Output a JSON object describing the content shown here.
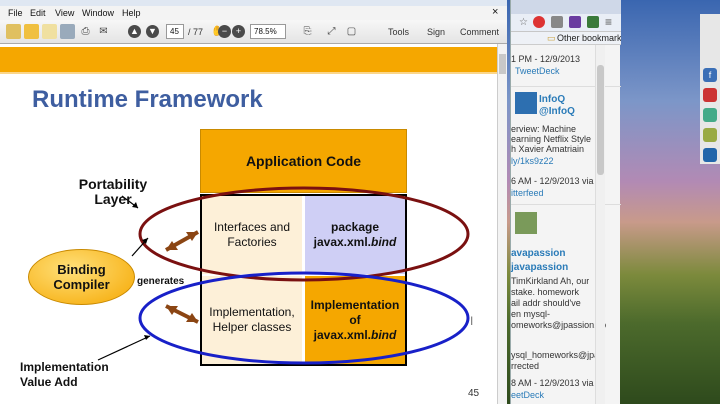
{
  "reader": {
    "menu": [
      "File",
      "Edit",
      "View",
      "Window",
      "Help"
    ],
    "page_current": "45",
    "page_total": "/ 77",
    "zoom": "78.5%",
    "tools_label": "Tools",
    "sign_label": "Sign",
    "comment_label": "Comment"
  },
  "slide": {
    "title": "Runtime Framework",
    "app_code": "Application Code",
    "portability": "Portability Layer",
    "interfaces": "Interfaces and Factories",
    "package_line1": "package",
    "package_line2": "javax.xml.",
    "package_italic": "bind",
    "binding_compiler": "Binding Compiler",
    "generates": "generates",
    "impl_helper": "Implementation, Helper classes",
    "impl_of_1": "Implementation",
    "impl_of_2": "of",
    "impl_of_3": "javax.xml.",
    "impl_of_italic": "bind",
    "impl_value_add": "Implementation Value Add",
    "page_number": "45"
  },
  "browser": {
    "bookmarks": "Other bookmarks",
    "tweets": [
      {
        "line1": "1 PM - 12/9/2013",
        "line2": "TweetDeck"
      },
      {
        "name": "InfoQ",
        "handle": "@InfoQ",
        "body": [
          "erview: Machine",
          "earning Netflix Style",
          "h Xavier Amatriain",
          "ly/1ks9z22"
        ],
        "time": "6 AM - 12/9/2013 via",
        "via": "itterfeed"
      },
      {
        "name": "avapassion",
        "handle": "javapassion",
        "body": [
          "TimKirkland Ah, our",
          "stake. homework",
          "ail addr should've",
          "en mysql-",
          "omeworks@jpassion.co"
        ],
        "extra": [
          "ysql_homeworks@jpas",
          "rrected"
        ],
        "time": "8 AM - 12/9/2013 via",
        "via": "eetDeck"
      }
    ]
  },
  "colors": {
    "title_blue": "#3e5ea0",
    "orange": "#f5a700",
    "cream": "#fdf0d8",
    "lilac": "#cfcff5",
    "ellipse_red": "#7a1010",
    "ellipse_blue": "#1820c8"
  }
}
